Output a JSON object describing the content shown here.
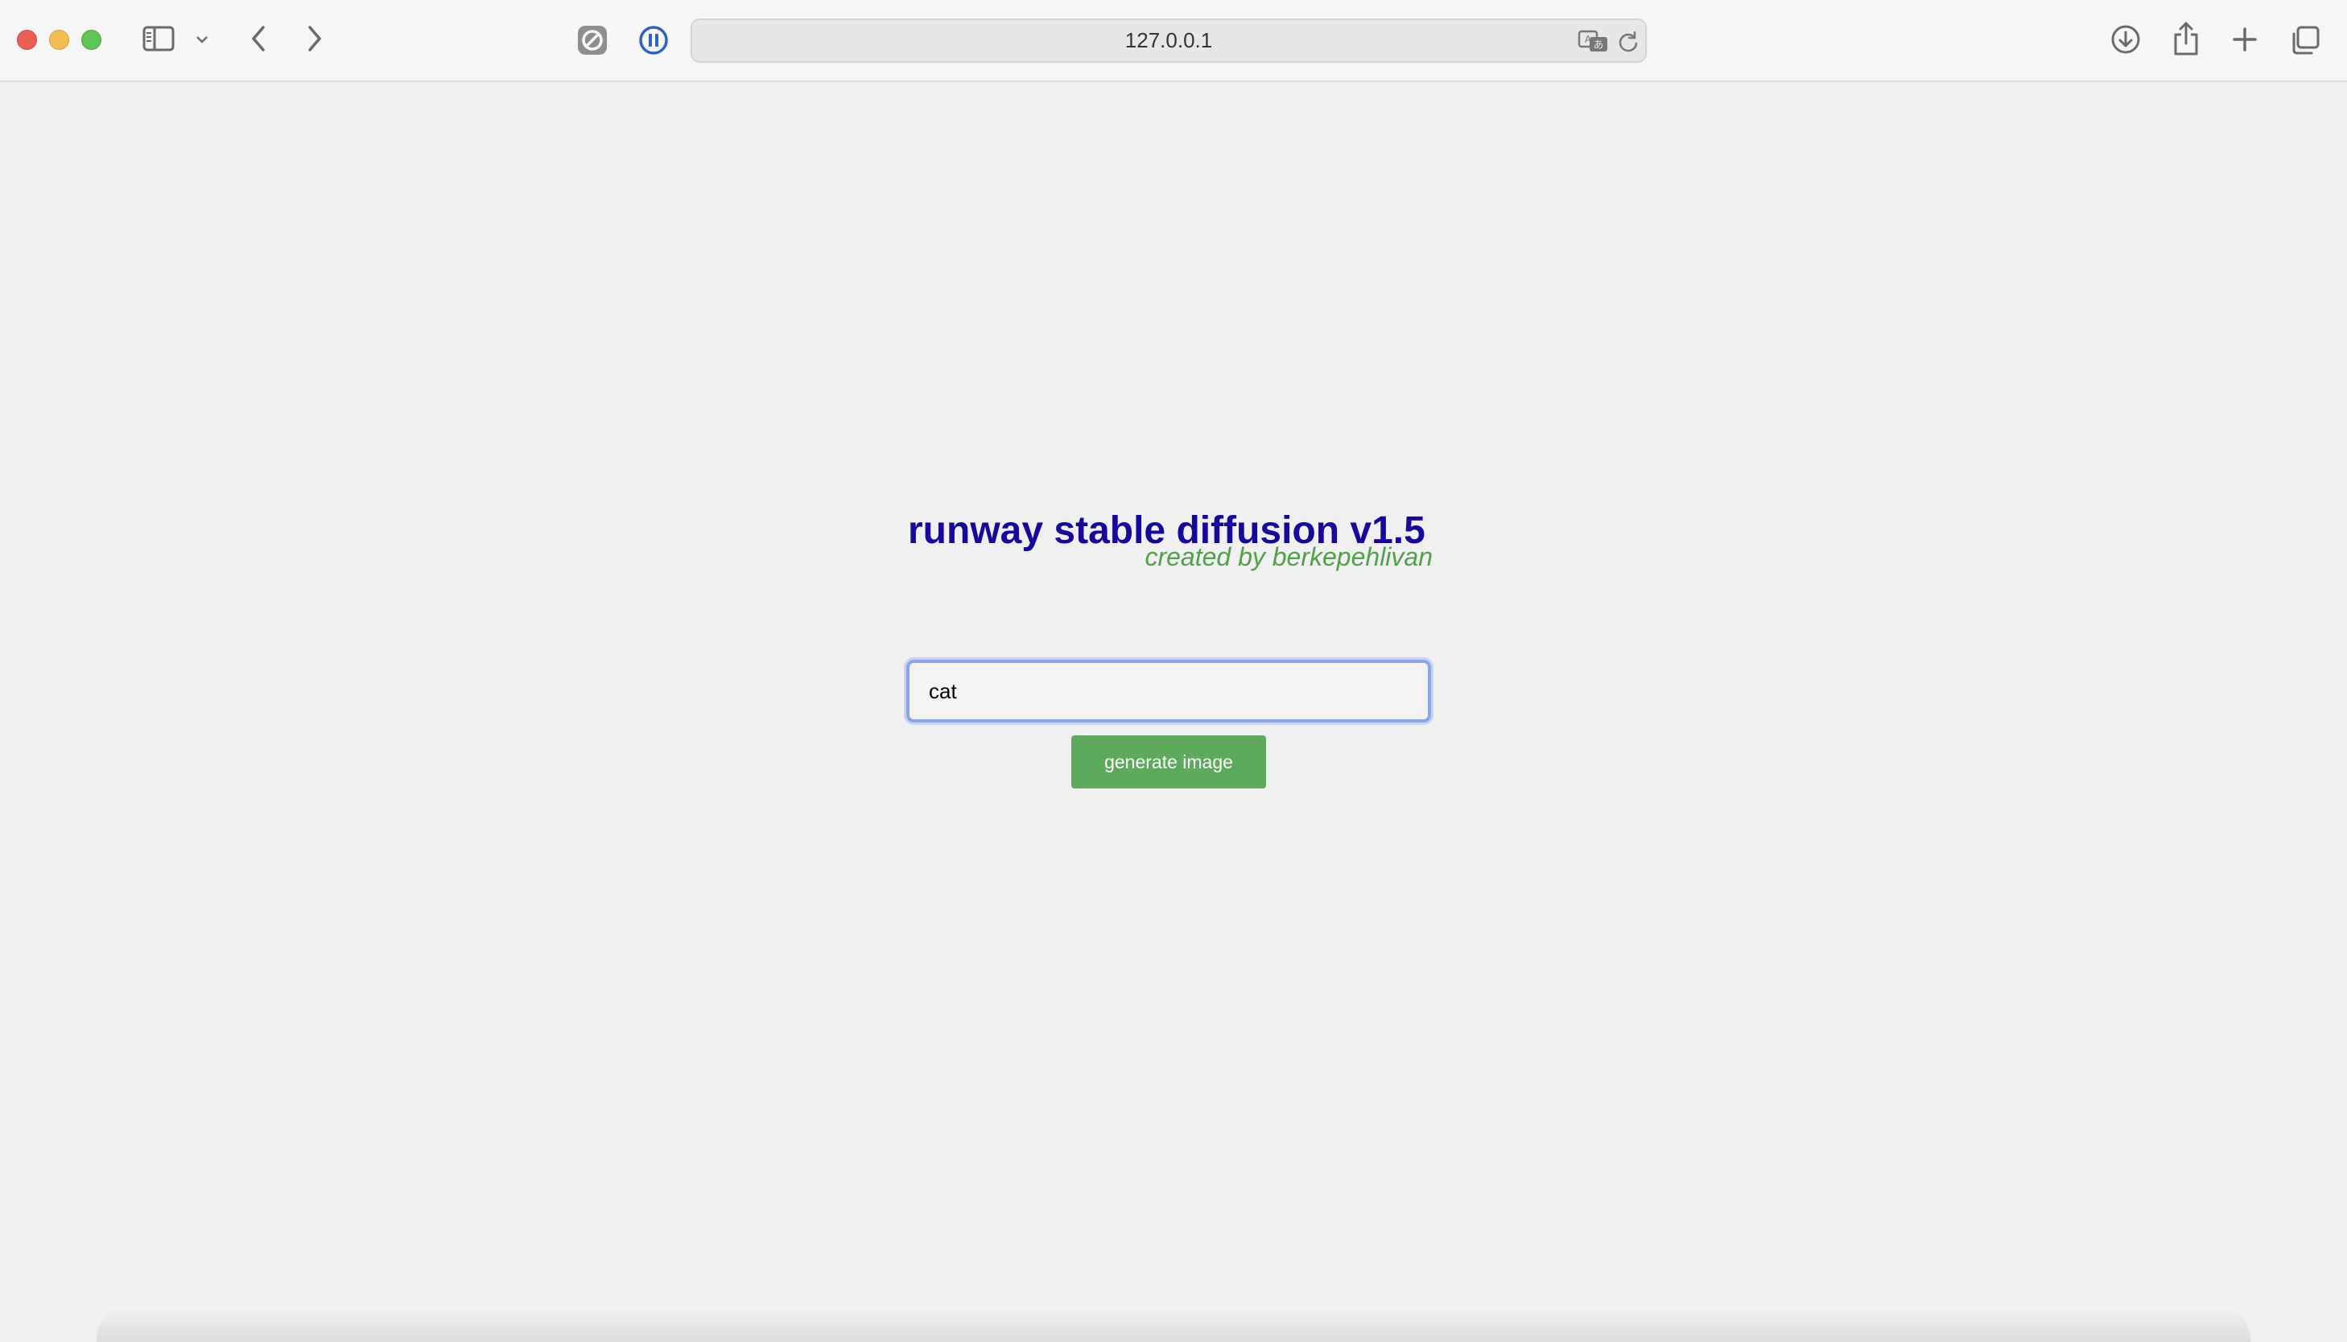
{
  "browser": {
    "url": "127.0.0.1",
    "icons": {
      "sidebar": "sidebar-icon",
      "sidebar_menu": "chevron-down-icon",
      "back": "chevron-left-icon",
      "forward": "chevron-right-icon",
      "blocker": "privacy-blocker-icon",
      "media": "pause-icon",
      "translate": "translate-icon",
      "reload": "reload-icon",
      "downloads": "download-icon",
      "share": "share-icon",
      "new_tab": "plus-icon",
      "tabs": "tab-overview-icon"
    }
  },
  "page": {
    "title": "runway stable diffusion v1.5",
    "subtitle": "created by berkepehlivan",
    "prompt_value": "cat",
    "button_label": "generate image"
  },
  "colors": {
    "title": "#15089b",
    "subtitle": "#53a04b",
    "button": "#5daa5c",
    "input_focus": "#8ea4e8",
    "background": "#f0f0f0"
  }
}
